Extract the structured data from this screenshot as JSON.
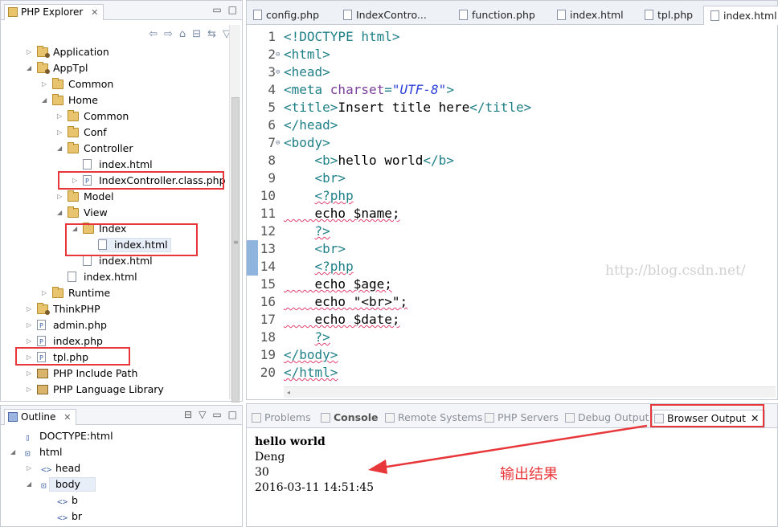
{
  "explorer": {
    "title": "PHP Explorer",
    "close": "✕",
    "tree": [
      {
        "id": "application",
        "label": "Application",
        "depth": 0,
        "icon": "project-folder",
        "twisty": "closed"
      },
      {
        "id": "apptpl",
        "label": "AppTpl",
        "depth": 0,
        "icon": "project-folder",
        "twisty": "open"
      },
      {
        "id": "common1",
        "label": "Common",
        "depth": 1,
        "icon": "folder",
        "twisty": "closed"
      },
      {
        "id": "home",
        "label": "Home",
        "depth": 1,
        "icon": "folder-open",
        "twisty": "open"
      },
      {
        "id": "common2",
        "label": "Common",
        "depth": 2,
        "icon": "folder",
        "twisty": "closed"
      },
      {
        "id": "conf",
        "label": "Conf",
        "depth": 2,
        "icon": "folder",
        "twisty": "closed"
      },
      {
        "id": "controller",
        "label": "Controller",
        "depth": 2,
        "icon": "folder-open",
        "twisty": "open"
      },
      {
        "id": "ctrl-index-html",
        "label": "index.html",
        "depth": 3,
        "icon": "file",
        "twisty": "none"
      },
      {
        "id": "indexcontroller",
        "label": "IndexController.class.php",
        "depth": 3,
        "icon": "php-file",
        "twisty": "closed"
      },
      {
        "id": "model",
        "label": "Model",
        "depth": 2,
        "icon": "folder",
        "twisty": "closed"
      },
      {
        "id": "view",
        "label": "View",
        "depth": 2,
        "icon": "folder-open",
        "twisty": "open"
      },
      {
        "id": "view-index",
        "label": "Index",
        "depth": 3,
        "icon": "folder-open",
        "twisty": "open"
      },
      {
        "id": "view-index-html",
        "label": "index.html",
        "depth": 4,
        "icon": "file",
        "twisty": "none",
        "selected": true
      },
      {
        "id": "view-html",
        "label": "index.html",
        "depth": 3,
        "icon": "file",
        "twisty": "none"
      },
      {
        "id": "home-html",
        "label": "index.html",
        "depth": 2,
        "icon": "file",
        "twisty": "none"
      },
      {
        "id": "runtime",
        "label": "Runtime",
        "depth": 1,
        "icon": "folder",
        "twisty": "closed"
      },
      {
        "id": "thinkphp",
        "label": "ThinkPHP",
        "depth": 0,
        "icon": "project-folder",
        "twisty": "closed"
      },
      {
        "id": "admin",
        "label": "admin.php",
        "depth": 0,
        "icon": "php-file",
        "twisty": "closed"
      },
      {
        "id": "indexphp",
        "label": "index.php",
        "depth": 0,
        "icon": "php-file",
        "twisty": "closed"
      },
      {
        "id": "tpl",
        "label": "tpl.php",
        "depth": 0,
        "icon": "php-file",
        "twisty": "closed"
      },
      {
        "id": "include",
        "label": "PHP Include Path",
        "depth": 0,
        "icon": "library",
        "twisty": "closed"
      },
      {
        "id": "langlib",
        "label": "PHP Language Library",
        "depth": 0,
        "icon": "library",
        "twisty": "closed"
      }
    ]
  },
  "editor": {
    "tabs": [
      {
        "label": "config.php",
        "active": false
      },
      {
        "label": "IndexContro...",
        "active": false
      },
      {
        "label": "function.php",
        "active": false
      },
      {
        "label": "index.html",
        "active": false
      },
      {
        "label": "tpl.php",
        "active": false
      },
      {
        "label": "index.html",
        "active": true
      }
    ],
    "close": "✕",
    "lines": [
      {
        "n": "1",
        "fold": "",
        "parts": [
          [
            "t-tag",
            "<!DOCTYPE html>"
          ]
        ]
      },
      {
        "n": "2",
        "fold": "⊖",
        "parts": [
          [
            "t-tag",
            "<html>"
          ]
        ]
      },
      {
        "n": "3",
        "fold": "⊖",
        "parts": [
          [
            "t-tag",
            "<head>"
          ]
        ]
      },
      {
        "n": "4",
        "fold": "",
        "parts": [
          [
            "t-tag",
            "<meta "
          ],
          [
            "t-attr",
            "charset"
          ],
          [
            "t-tag",
            "="
          ],
          [
            "t-str",
            "\"UTF-8\""
          ],
          [
            "t-tag",
            ">"
          ]
        ]
      },
      {
        "n": "5",
        "fold": "",
        "parts": [
          [
            "t-tag",
            "<title>"
          ],
          [
            "t-txt",
            "Insert title here"
          ],
          [
            "t-tag",
            "</title>"
          ]
        ]
      },
      {
        "n": "6",
        "fold": "",
        "parts": [
          [
            "t-tag",
            "</head>"
          ]
        ]
      },
      {
        "n": "7",
        "fold": "⊖",
        "parts": [
          [
            "t-tag",
            "<body>"
          ]
        ]
      },
      {
        "n": "8",
        "fold": "",
        "parts": [
          [
            "t-txt",
            "    "
          ],
          [
            "t-tag",
            "<b>"
          ],
          [
            "t-txt",
            "hello world"
          ],
          [
            "t-tag",
            "</b>"
          ]
        ]
      },
      {
        "n": "9",
        "fold": "",
        "parts": [
          [
            "t-txt",
            "    "
          ],
          [
            "t-tag",
            "<br>"
          ]
        ]
      },
      {
        "n": "10",
        "fold": "",
        "parts": [
          [
            "t-txt",
            "    "
          ],
          [
            "t-php squig",
            "<?php"
          ]
        ]
      },
      {
        "n": "11",
        "fold": "",
        "parts": [
          [
            "t-txt squig",
            "    echo $name;"
          ]
        ]
      },
      {
        "n": "12",
        "fold": "",
        "parts": [
          [
            "t-txt",
            "    "
          ],
          [
            "t-php squig",
            "?>"
          ]
        ]
      },
      {
        "n": "13",
        "fold": "",
        "parts": [
          [
            "t-txt",
            "    "
          ],
          [
            "t-tag",
            "<br>"
          ]
        ],
        "marker": true
      },
      {
        "n": "14",
        "fold": "",
        "parts": [
          [
            "t-txt",
            "    "
          ],
          [
            "t-php squig",
            "<?php"
          ]
        ],
        "marker": true
      },
      {
        "n": "15",
        "fold": "",
        "parts": [
          [
            "t-txt squig",
            "    echo $age;"
          ]
        ]
      },
      {
        "n": "16",
        "fold": "",
        "parts": [
          [
            "t-txt squig",
            "    echo \"<br>\";"
          ]
        ]
      },
      {
        "n": "17",
        "fold": "",
        "parts": [
          [
            "t-txt squig",
            "    echo $date;"
          ]
        ]
      },
      {
        "n": "18",
        "fold": "",
        "parts": [
          [
            "t-txt",
            "    "
          ],
          [
            "t-php squig",
            "?>"
          ]
        ]
      },
      {
        "n": "19",
        "fold": "",
        "parts": [
          [
            "t-tag squig",
            "</body>"
          ]
        ]
      },
      {
        "n": "20",
        "fold": "",
        "parts": [
          [
            "t-tag squig",
            "</html>"
          ]
        ]
      }
    ],
    "watermark": "http://blog.csdn.net/"
  },
  "outline": {
    "title": "Outline",
    "close": "✕",
    "tree": [
      {
        "label": "DOCTYPE:html",
        "depth": 0,
        "twisty": "none",
        "icon": "doctype"
      },
      {
        "label": "html",
        "depth": 0,
        "twisty": "open",
        "icon": "element"
      },
      {
        "label": "head",
        "depth": 1,
        "twisty": "closed",
        "icon": "tag"
      },
      {
        "label": "body",
        "depth": 1,
        "twisty": "open",
        "icon": "element",
        "selected": true
      },
      {
        "label": "b",
        "depth": 2,
        "twisty": "none",
        "icon": "tag"
      },
      {
        "label": "br",
        "depth": 2,
        "twisty": "none",
        "icon": "tag"
      }
    ]
  },
  "console": {
    "tabs": [
      {
        "label": "Problems",
        "style": "normal"
      },
      {
        "label": "Console",
        "style": "bold"
      },
      {
        "label": "Remote Systems",
        "style": "normal"
      },
      {
        "label": "PHP Servers",
        "style": "normal"
      },
      {
        "label": "Debug Output",
        "style": "normal"
      },
      {
        "label": "Browser Output",
        "style": "active"
      }
    ],
    "close": "✕",
    "output": {
      "line1": "hello world",
      "line2": "Deng",
      "line3": "30",
      "line4": "2016-03-11 14:51:45"
    }
  },
  "annotation": {
    "text": "输出结果",
    "color": "#e8373a"
  }
}
